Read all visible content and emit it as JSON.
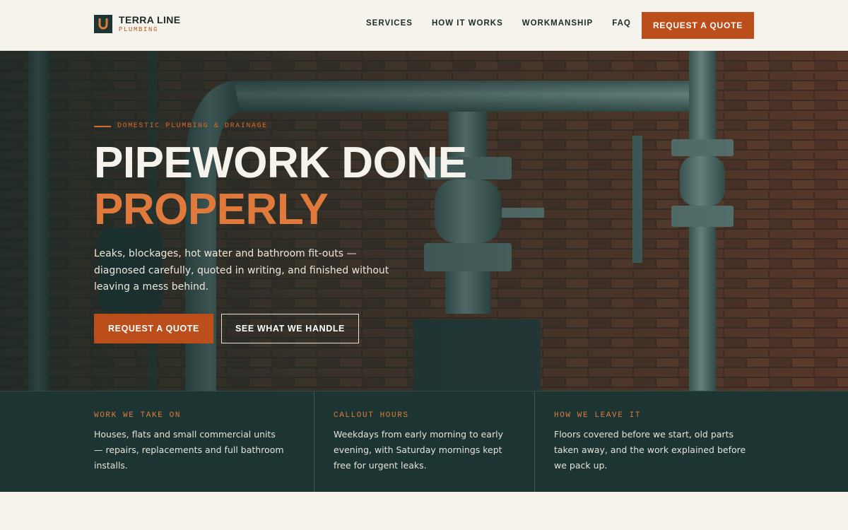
{
  "brand": {
    "name": "TERRA LINE",
    "subtitle": "PLUMBING",
    "logo_icon": "u-magnet-icon",
    "colors": {
      "dark": "#1c3532",
      "accent": "#bc4e1b",
      "accent_text": "#df7a3c",
      "cream": "#f6f2ec"
    }
  },
  "nav": {
    "items": [
      {
        "label": "SERVICES"
      },
      {
        "label": "HOW IT WORKS"
      },
      {
        "label": "WORKMANSHIP"
      },
      {
        "label": "FAQ"
      }
    ],
    "cta_label": "REQUEST A QUOTE"
  },
  "hero": {
    "eyebrow": "DOMESTIC PLUMBING & DRAINAGE",
    "headline_line1": "PIPEWORK DONE",
    "headline_line2": "PROPERLY",
    "lede": "Leaks, blockages, hot water and bathroom fit-outs — diagnosed carefully, quoted in writing, and finished without leaving a mess behind.",
    "primary_button": "REQUEST A QUOTE",
    "secondary_button": "SEE WHAT WE HANDLE",
    "background": "industrial-pipes-on-brick-wall-photo"
  },
  "info": [
    {
      "title": "WORK WE TAKE ON",
      "body": "Houses, flats and small commercial units — repairs, replacements and full bathroom installs."
    },
    {
      "title": "CALLOUT HOURS",
      "body": "Weekdays from early morning to early evening, with Saturday mornings kept free for urgent leaks."
    },
    {
      "title": "HOW WE LEAVE IT",
      "body": "Floors covered before we start, old parts taken away, and the work explained before we pack up."
    }
  ]
}
